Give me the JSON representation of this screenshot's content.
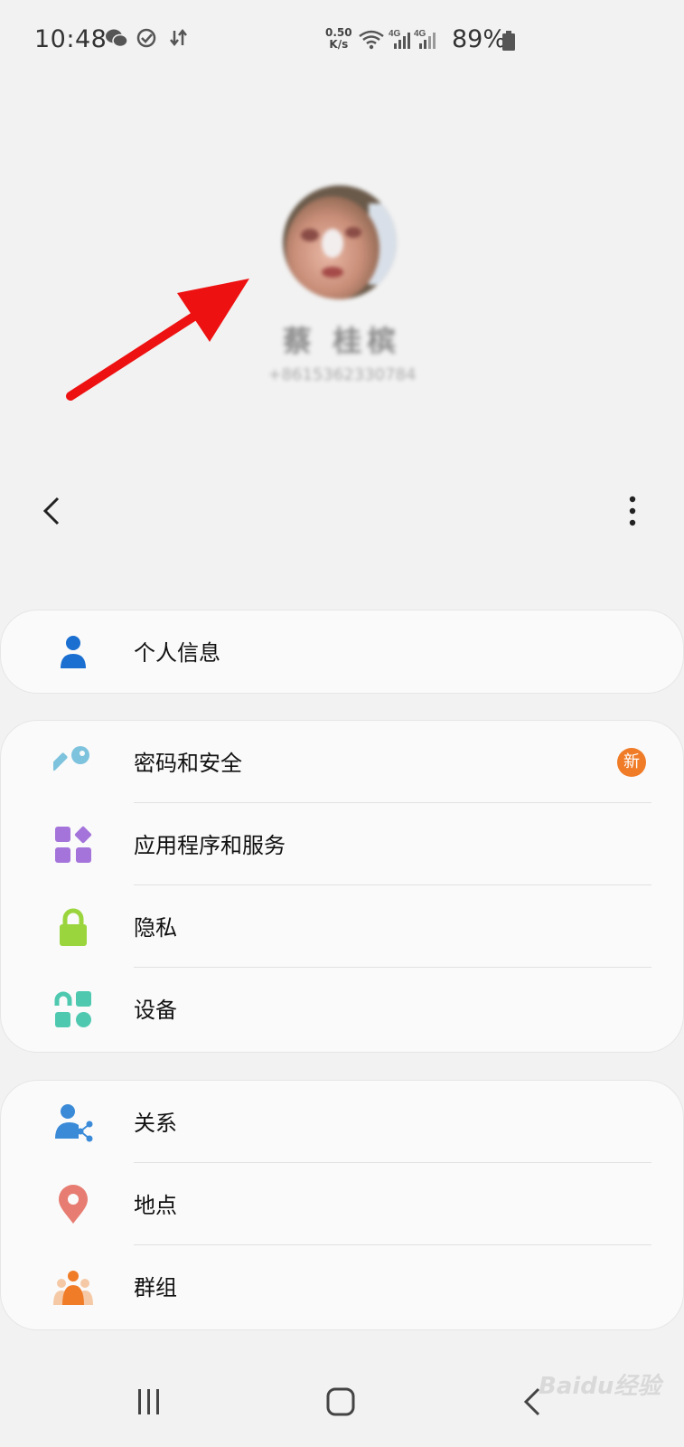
{
  "status_bar": {
    "time": "10:48",
    "speed_value": "0.50",
    "speed_unit": "K/s",
    "battery": "89%"
  },
  "profile": {
    "name": "蔡 桂槟",
    "phone": "+8615362330784"
  },
  "cards": [
    {
      "items": [
        {
          "label": "个人信息",
          "icon": "person-icon",
          "color": "#1a6fd1"
        }
      ]
    },
    {
      "items": [
        {
          "label": "密码和安全",
          "icon": "key-icon",
          "color": "#7ec3dd",
          "badge": "新"
        },
        {
          "label": "应用程序和服务",
          "icon": "apps-grid-icon",
          "color": "#a474db"
        },
        {
          "label": "隐私",
          "icon": "lock-icon",
          "color": "#9ad53e"
        },
        {
          "label": "设备",
          "icon": "device-icon",
          "color": "#4ec9b0"
        }
      ]
    },
    {
      "items": [
        {
          "label": "关系",
          "icon": "share-person-icon",
          "color": "#3a8ad8"
        },
        {
          "label": "地点",
          "icon": "location-pin-icon",
          "color": "#e77d72"
        },
        {
          "label": "群组",
          "icon": "group-icon",
          "color": "#f07c28"
        }
      ]
    }
  ],
  "watermark": "Baidu经验"
}
